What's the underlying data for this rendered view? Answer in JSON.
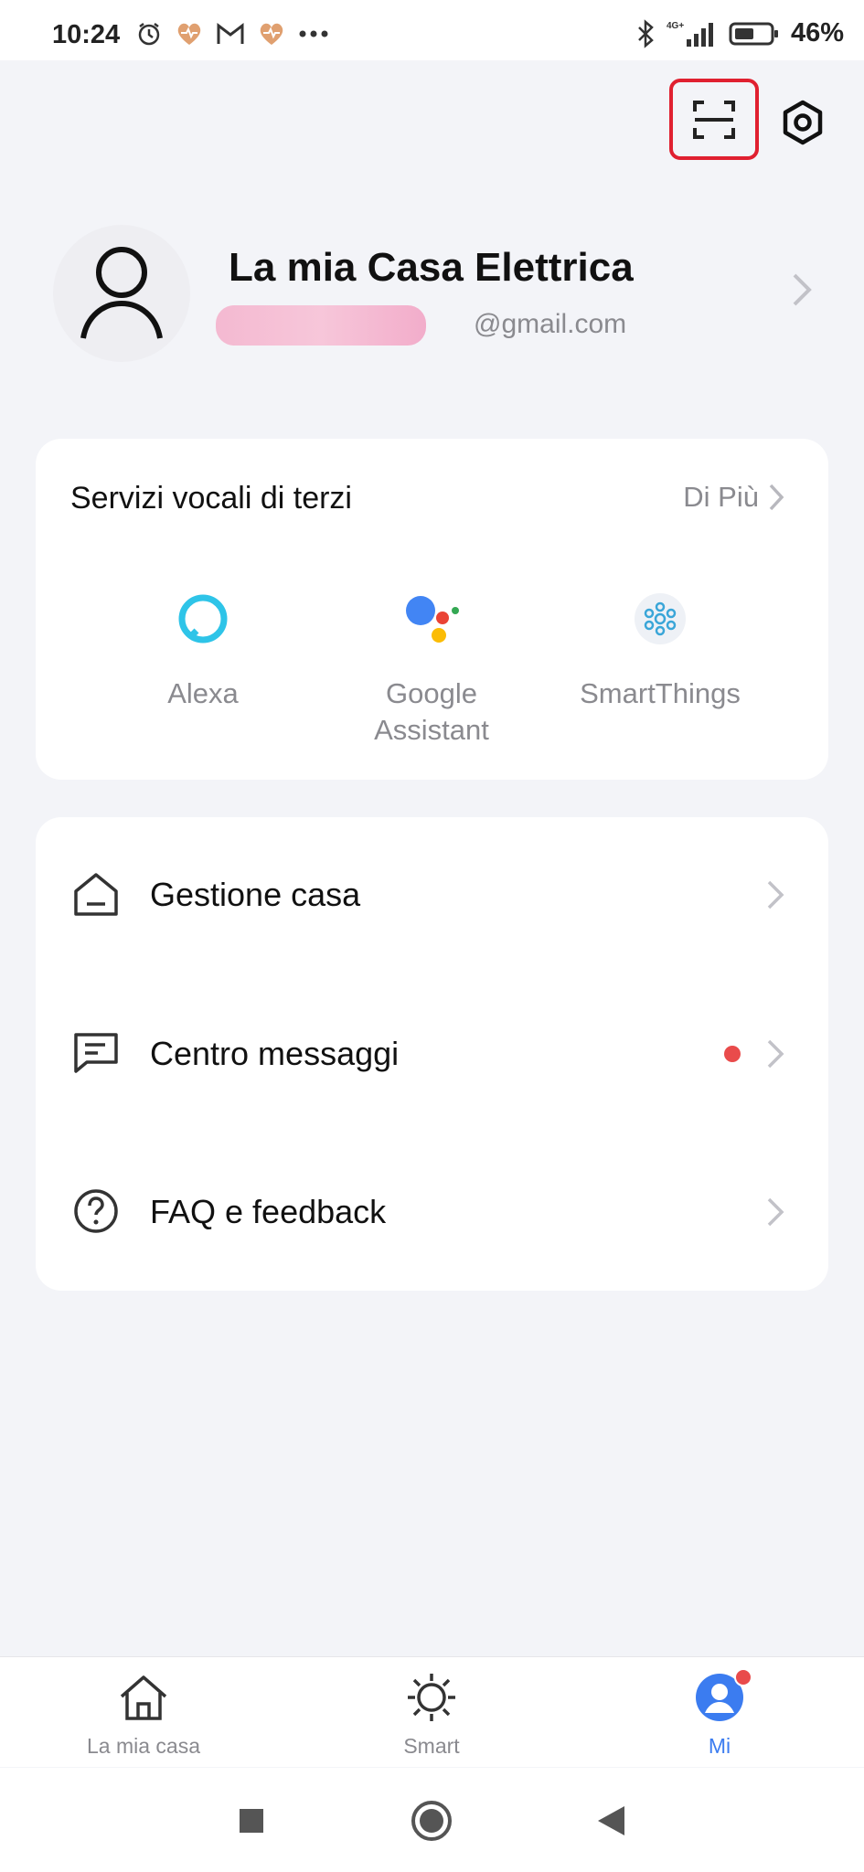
{
  "status_bar": {
    "time": "10:24",
    "battery": "46%",
    "network": "4G+"
  },
  "profile": {
    "name": "La mia Casa Elettrica",
    "email_visible": "@gmail.com"
  },
  "voice_services": {
    "title": "Servizi vocali di terzi",
    "more_label": "Di Più",
    "items": [
      {
        "label": "Alexa",
        "icon": "alexa-icon"
      },
      {
        "label": "Google\nAssistant",
        "icon": "google-assistant-icon"
      },
      {
        "label": "SmartThings",
        "icon": "smartthings-icon"
      }
    ]
  },
  "menu": {
    "items": [
      {
        "label": "Gestione casa",
        "icon": "house-icon"
      },
      {
        "label": "Centro messaggi",
        "icon": "message-icon",
        "has_notification": true
      },
      {
        "label": "FAQ e feedback",
        "icon": "help-icon"
      }
    ]
  },
  "tabs": [
    {
      "label": "La mia casa",
      "icon": "home-icon",
      "active": false
    },
    {
      "label": "Smart",
      "icon": "sun-icon",
      "active": false
    },
    {
      "label": "Mi",
      "icon": "user-icon",
      "active": true,
      "badge": true
    }
  ],
  "colors": {
    "accent": "#3b7cf0",
    "badge": "#e94b4b",
    "highlight_border": "#e02030",
    "background": "#f3f4f8"
  }
}
